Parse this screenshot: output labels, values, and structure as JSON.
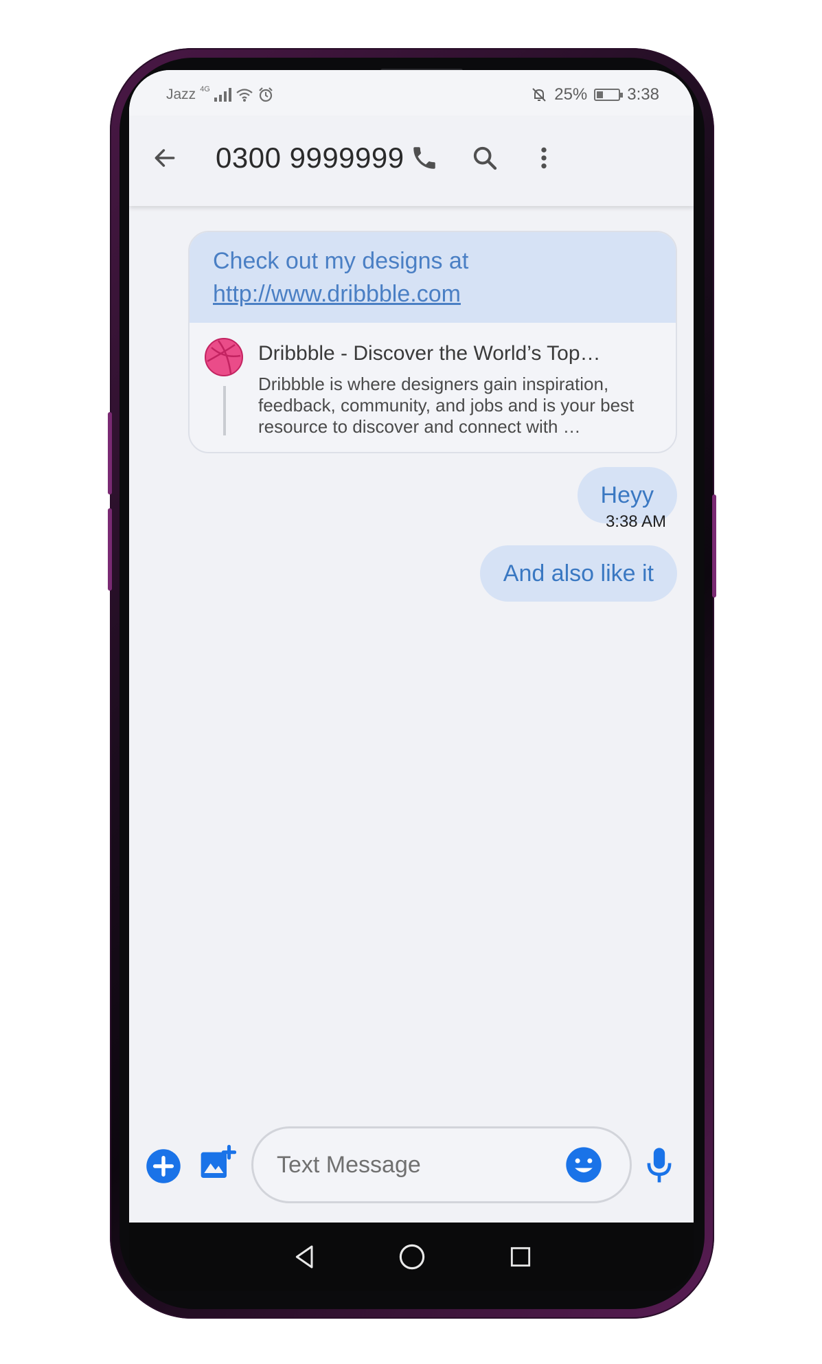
{
  "status_bar": {
    "carrier": "Jazz",
    "network": "4G",
    "battery": "25%",
    "time": "3:38"
  },
  "app_bar": {
    "title": "0300 9999999",
    "icons": [
      "back-arrow-icon",
      "phone-icon",
      "search-icon",
      "more-vert-icon"
    ]
  },
  "messages": {
    "link_message": {
      "text": "Check out my designs at",
      "url": "http://www.dribbble.com",
      "preview_title": "Dribbble - Discover the World’s Top…",
      "preview_description": "Dribbble is where designers gain inspiration, feedback, community, and jobs and is your best resource to discover and connect with …"
    },
    "items": [
      {
        "text": "Heyy"
      },
      {
        "text": "And also like it"
      }
    ],
    "timestamp": "3:38 AM"
  },
  "compose": {
    "placeholder": "Text Message"
  },
  "colors": {
    "bubble": "#d6e2f5",
    "bubble_text": "#3a78c2",
    "accent": "#1a73e8",
    "background": "#f1f2f6",
    "frame": "#4a1846"
  }
}
